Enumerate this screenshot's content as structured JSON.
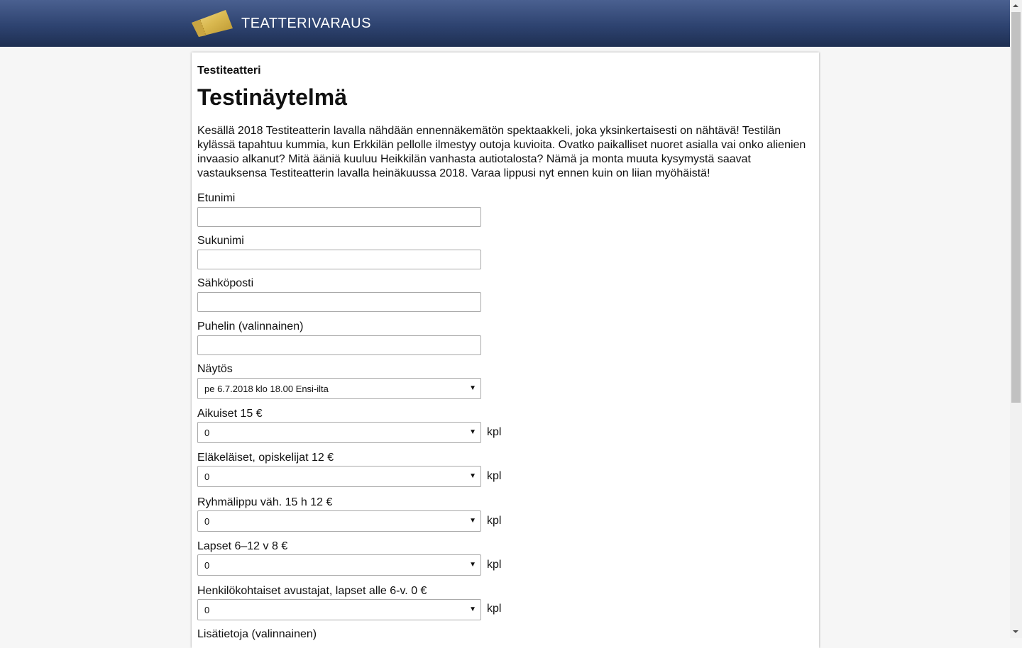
{
  "header": {
    "brand_name": "TEATTERIVARAUS",
    "logo_icon": "ticket-icon"
  },
  "event": {
    "theater": "Testiteatteri",
    "title": "Testinäytelmä",
    "description": "Kesällä 2018 Testiteatterin lavalla nähdään ennennäkemätön spektaakkeli, joka yksinkertaisesti on nähtävä! Testilän kylässä tapahtuu kummia, kun Erkkilän pellolle ilmestyy outoja kuvioita. Ovatko paikalliset nuoret asialla vai onko alienien invaasio alkanut? Mitä ääniä kuuluu Heikkilän vanhasta autiotalosta? Nämä ja monta muuta kysymystä saavat vastauksensa Testiteatterin lavalla heinäkuussa 2018. Varaa lippusi nyt ennen kuin on liian myöhäistä!"
  },
  "form": {
    "first_name": {
      "label": "Etunimi",
      "value": ""
    },
    "last_name": {
      "label": "Sukunimi",
      "value": ""
    },
    "email": {
      "label": "Sähköposti",
      "value": ""
    },
    "phone": {
      "label": "Puhelin (valinnainen)",
      "value": ""
    },
    "show": {
      "label": "Näytös",
      "selected": "pe 6.7.2018 klo 18.00 Ensi-ilta"
    },
    "tickets": [
      {
        "label": "Aikuiset 15 €",
        "selected": "0",
        "unit": "kpl"
      },
      {
        "label": "Eläkeläiset, opiskelijat 12 €",
        "selected": "0",
        "unit": "kpl"
      },
      {
        "label": "Ryhmälippu väh. 15 h 12 €",
        "selected": "0",
        "unit": "kpl"
      },
      {
        "label": "Lapset 6–12 v 8 €",
        "selected": "0",
        "unit": "kpl"
      },
      {
        "label": "Henkilökohtaiset avustajat, lapset alle 6-v. 0 €",
        "selected": "0",
        "unit": "kpl"
      }
    ],
    "extra_info": {
      "label": "Lisätietoja (valinnainen)"
    }
  },
  "colors": {
    "header_top": "#4a6090",
    "header_bottom": "#1e2f52",
    "ticket_gold": "#d9b84f"
  }
}
